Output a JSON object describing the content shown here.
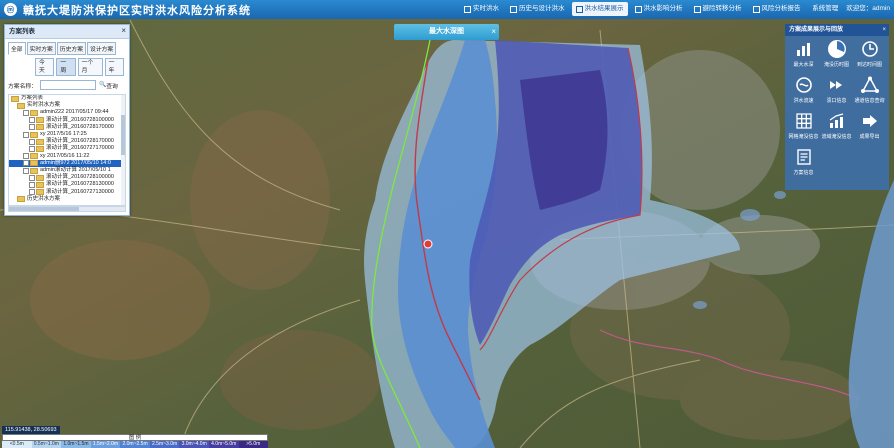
{
  "header": {
    "logo_text": "ⓜ",
    "title": "赣抚大堤防洪保护区实时洪水风险分析系统",
    "nav": [
      {
        "label": "实时洪水",
        "active": false
      },
      {
        "label": "历史与设计洪水",
        "active": false
      },
      {
        "label": "洪水结果展示",
        "active": true
      },
      {
        "label": "洪水影响分析",
        "active": false
      },
      {
        "label": "避险转移分析",
        "active": false
      },
      {
        "label": "风险分析报告",
        "active": false
      }
    ],
    "system_manage": "系统管理",
    "welcome": "欢迎您：admin"
  },
  "left_panel": {
    "title": "方案列表",
    "close": "×",
    "tabs": [
      "全部",
      "实时方案",
      "历史方案",
      "设计方案"
    ],
    "time_buttons": [
      "今天",
      "一周",
      "一个月",
      "一年"
    ],
    "search_label": "方案名称：",
    "search_button": "查询",
    "tree": [
      {
        "indent": 0,
        "type": "folder",
        "label": "方案列表",
        "selected": false
      },
      {
        "indent": 1,
        "type": "folder",
        "label": "实时洪水方案",
        "selected": false
      },
      {
        "indent": 2,
        "type": "check",
        "label": "admin222 2017/05/17 09:44",
        "selected": false
      },
      {
        "indent": 3,
        "type": "check",
        "label": "滚动计算_20160728100000",
        "selected": false
      },
      {
        "indent": 3,
        "type": "check",
        "label": "滚动计算_20160728170000",
        "selected": false
      },
      {
        "indent": 2,
        "type": "check",
        "label": "xy 2017/5/16 17:25",
        "selected": false
      },
      {
        "indent": 3,
        "type": "check",
        "label": "滚动计算_20160728170000",
        "selected": false
      },
      {
        "indent": 3,
        "type": "check",
        "label": "滚动计算_20160727170000",
        "selected": false
      },
      {
        "indent": 2,
        "type": "check",
        "label": "xy 2017/05/16 11:22",
        "selected": false
      },
      {
        "indent": 2,
        "type": "check",
        "label": "admin删972 2017/05/10 14:0",
        "selected": true
      },
      {
        "indent": 2,
        "type": "check",
        "label": "admin滚动计算 2017/05/10 1",
        "selected": false
      },
      {
        "indent": 3,
        "type": "check",
        "label": "滚动计算_20160728100000",
        "selected": false
      },
      {
        "indent": 3,
        "type": "check",
        "label": "滚动计算_20160728130000",
        "selected": false
      },
      {
        "indent": 3,
        "type": "check",
        "label": "滚动计算_20160727130000",
        "selected": false
      },
      {
        "indent": 1,
        "type": "folder",
        "label": "历史洪水方案",
        "selected": false
      }
    ]
  },
  "banner": {
    "label": "最大水深图",
    "close": "×"
  },
  "right_panel": {
    "title": "方案成果展示与回放",
    "close": "×",
    "tools": [
      {
        "label": "最大水深",
        "icon": "depth-chart-icon"
      },
      {
        "label": "淹没历时图",
        "icon": "pie-clock-icon"
      },
      {
        "label": "到达时间图",
        "icon": "clock-icon"
      },
      {
        "label": "洪水流速",
        "icon": "flow-speed-icon"
      },
      {
        "label": "溃口信息",
        "icon": "breach-icon"
      },
      {
        "label": "通道信息查询",
        "icon": "network-icon"
      },
      {
        "label": "网格淹没信息",
        "icon": "grid-icon"
      },
      {
        "label": "流域淹没信息",
        "icon": "trend-chart-icon"
      },
      {
        "label": "成果导出",
        "icon": "export-icon"
      },
      {
        "label": "方案信息",
        "icon": "document-icon"
      }
    ]
  },
  "status": {
    "coordinates": "115.91438, 28.50693"
  },
  "legend": {
    "title": "图 例",
    "items": [
      {
        "label": "<0.5m",
        "color": "#dcebf8",
        "text": "#234"
      },
      {
        "label": "0.5m~1.0m",
        "color": "#b4d4f0",
        "text": "#234"
      },
      {
        "label": "1.0m~1.5m",
        "color": "#8ab9e6",
        "text": "#123"
      },
      {
        "label": "1.5m~2.0m",
        "color": "#6a9ddd",
        "text": "#fff"
      },
      {
        "label": "2.0m~2.5m",
        "color": "#5283d2",
        "text": "#fff"
      },
      {
        "label": "2.5m~3.0m",
        "color": "#4a6cc6",
        "text": "#fff"
      },
      {
        "label": "3.0m~4.0m",
        "color": "#4c54b6",
        "text": "#fff"
      },
      {
        "label": "4.0m~5.0m",
        "color": "#473c9f",
        "text": "#fff"
      },
      {
        "label": ">5.0m",
        "color": "#3a2a85",
        "text": "#fff"
      }
    ]
  }
}
